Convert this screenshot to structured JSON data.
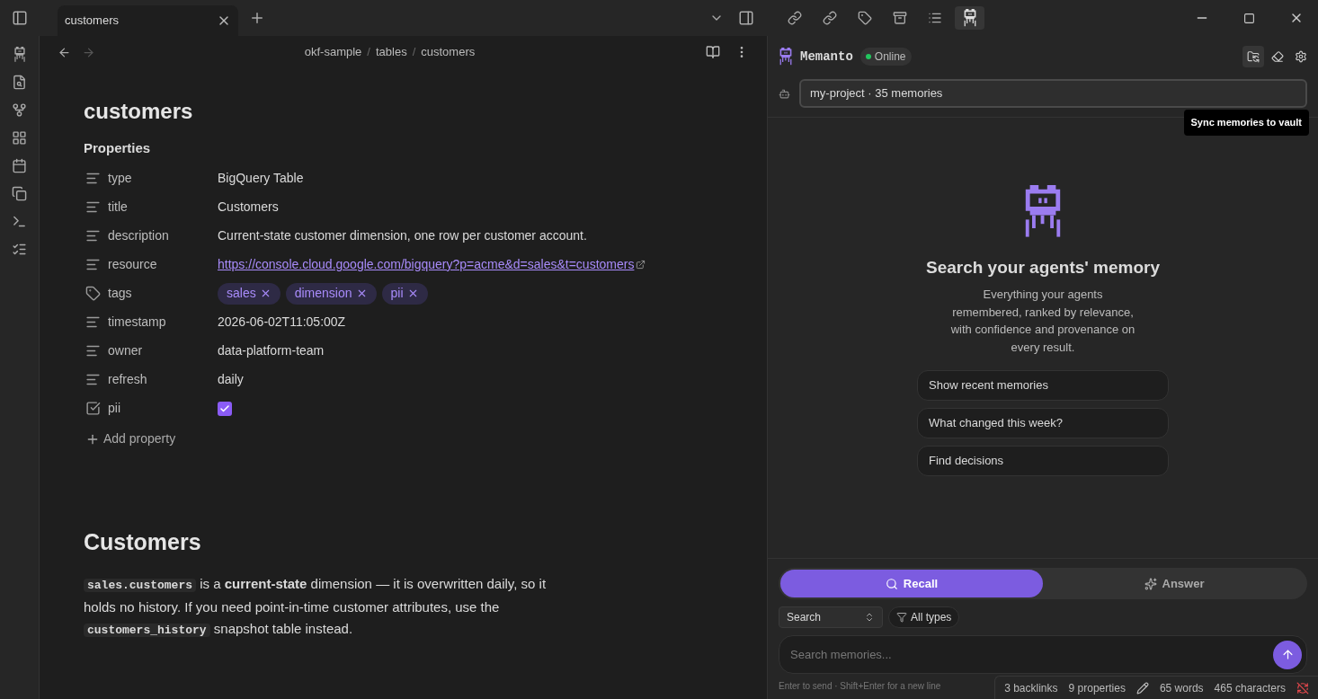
{
  "tab": {
    "title": "customers",
    "selected": true
  },
  "breadcrumb": [
    {
      "kind": "item",
      "text": "okf-sample"
    },
    {
      "kind": "separator",
      "text": "/"
    },
    {
      "kind": "item",
      "text": "tables"
    },
    {
      "kind": "separator",
      "text": "/"
    },
    {
      "kind": "item",
      "text": "customers"
    }
  ],
  "note": {
    "title": "customers",
    "properties_heading": "Properties",
    "properties": [
      {
        "kind": "text",
        "name": "type",
        "value": "BigQuery Table"
      },
      {
        "kind": "text",
        "name": "title",
        "value": "Customers"
      },
      {
        "kind": "text",
        "name": "description",
        "value": "Current-state customer dimension, one row per customer account."
      },
      {
        "kind": "link",
        "name": "resource",
        "value": "https://console.cloud.google.com/bigquery?p=acme&d=sales&t=customers"
      },
      {
        "kind": "tags",
        "name": "tags",
        "tags": [
          "sales",
          "dimension",
          "pii"
        ]
      },
      {
        "kind": "text",
        "name": "timestamp",
        "value": "2026-06-02T11:05:00Z"
      },
      {
        "kind": "text",
        "name": "owner",
        "value": "data-platform-team"
      },
      {
        "kind": "text",
        "name": "refresh",
        "value": "daily"
      },
      {
        "kind": "checkbox",
        "name": "pii",
        "checked": true
      }
    ],
    "add_property": "Add property",
    "heading": "Customers",
    "paragraph": [
      {
        "kind": "code",
        "text": "sales.customers"
      },
      {
        "kind": "text",
        "text": " is a **current-state** dimension — it is overwritten daily, so it holds no history. If you need point-in-time customer attributes, use the "
      },
      {
        "kind": "code",
        "text": "customers_history"
      },
      {
        "kind": "text",
        "text": " snapshot table instead."
      }
    ]
  },
  "panel": {
    "tabs": [
      {
        "selected": false
      },
      {
        "selected": false
      },
      {
        "selected": false
      },
      {
        "selected": false
      },
      {
        "selected": false
      },
      {
        "selected": true
      }
    ],
    "title": "Memanto",
    "status": "Online",
    "online": true,
    "tooltip": "Sync memories to vault",
    "project": "my-project · 35 memories",
    "empty_title": "Search your agents' memory",
    "empty_text": "Everything your agents remembered, ranked by relevance, with confidence and provenance on every result.",
    "suggestions": [
      "Show recent memories",
      "What changed this week?",
      "Find decisions"
    ],
    "modes": [
      {
        "label": "Recall",
        "selected": true
      },
      {
        "label": "Answer",
        "selected": false
      }
    ],
    "search_mode": "Search",
    "type_filter": "All types",
    "input_placeholder": "Search memories...",
    "hint": "Enter to send · Shift+Enter for a new line"
  },
  "status_bar": [
    "3 backlinks",
    "9 properties",
    "65 words",
    "465 characters"
  ]
}
